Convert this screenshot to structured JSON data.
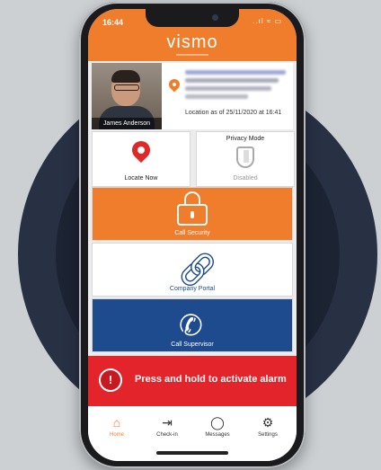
{
  "status_bar": {
    "time": "16:44",
    "icons": "..ıl ≈ ▭"
  },
  "app": {
    "brand": "vismo"
  },
  "profile": {
    "name": "James Anderson",
    "location_time": "Location as of 25/11/2020 at 16:41"
  },
  "tiles": {
    "locate": {
      "label": "Locate Now"
    },
    "privacy": {
      "title": "Privacy Mode",
      "status": "Disabled"
    }
  },
  "actions": {
    "security": {
      "label": "Call Security"
    },
    "portal": {
      "label": "Company Portal"
    },
    "supervisor": {
      "label": "Call Supervisor"
    }
  },
  "alarm": {
    "badge": "!",
    "label": "Press and hold to activate alarm"
  },
  "tabs": [
    {
      "label": "Home",
      "icon": "⌂"
    },
    {
      "label": "Check-in",
      "icon": "⇥"
    },
    {
      "label": "Messages",
      "icon": "◯"
    },
    {
      "label": "Settings",
      "icon": "⚙"
    }
  ],
  "colors": {
    "orange": "#ef7d2c",
    "navy": "#1d4b8d",
    "red": "#e3242b",
    "background_ring": "#283044"
  }
}
